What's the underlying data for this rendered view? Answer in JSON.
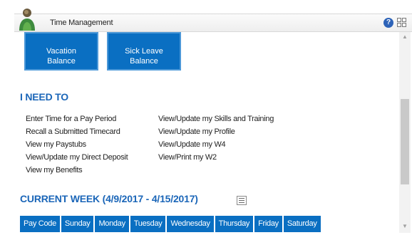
{
  "window": {
    "title": "Time Management",
    "help_glyph": "?",
    "minimize_glyph": "-",
    "icons": [
      "person-icon",
      "help-icon",
      "tile-view-icon",
      "minimize-icon"
    ]
  },
  "buttons": {
    "vacation": [
      "Vacation",
      "Balance"
    ],
    "sick": [
      "Sick Leave",
      "Balance"
    ]
  },
  "i_need_to": {
    "heading": "I NEED TO",
    "left": [
      "Enter Time for a Pay Period",
      "Recall a Submitted Timecard",
      "View my Paystubs",
      "View/Update my Direct Deposit",
      "View my Benefits"
    ],
    "right": [
      "View/Update my Skills and Training",
      "View/Update my Profile",
      "View/Update my W4",
      "View/Print my W2"
    ]
  },
  "current_week": {
    "heading": "CURRENT WEEK (4/9/2017 - 4/15/2017)",
    "columns": [
      "Pay Code",
      "Sunday",
      "Monday",
      "Tuesday",
      "Wednesday",
      "Thursday",
      "Friday",
      "Saturday"
    ]
  },
  "colors": {
    "accent": "#0a6fc2",
    "heading": "#1b66b8"
  }
}
